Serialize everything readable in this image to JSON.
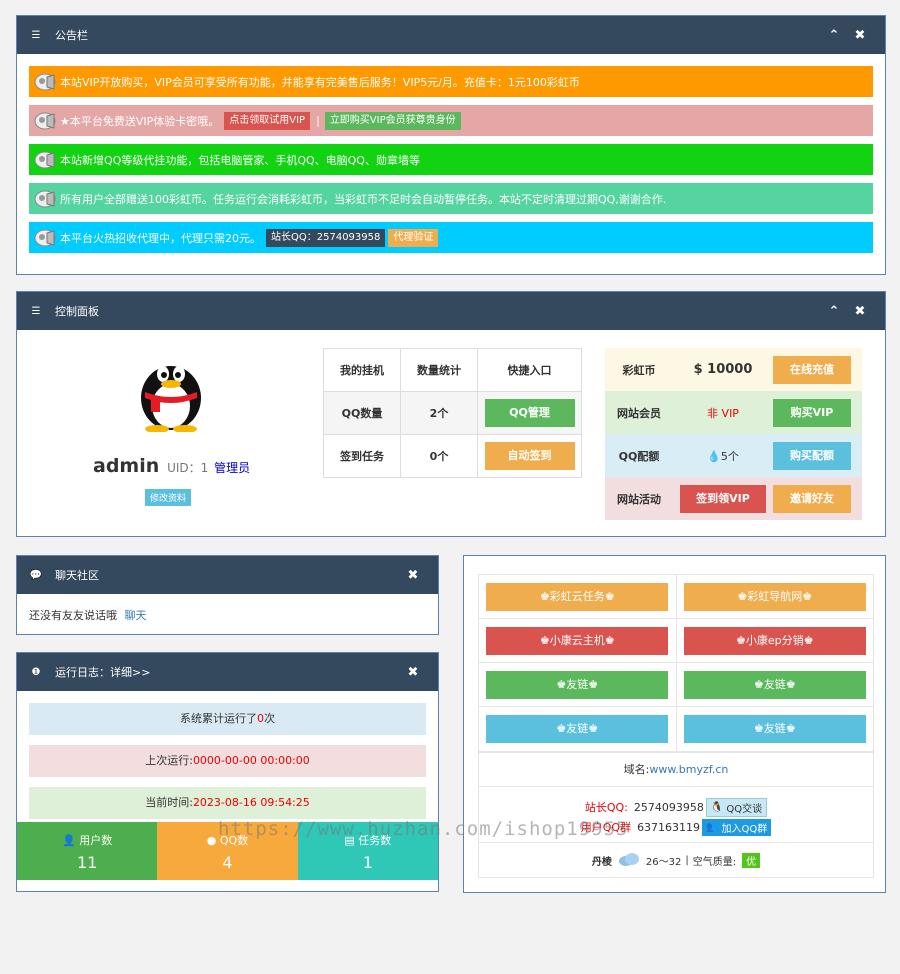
{
  "notice_panel": {
    "title": "公告栏",
    "notices": [
      {
        "text": "本站VIP开放购买，VIP会员可享受所有功能，并能享有完美售后服务！VIP5元/月。充值卡：1元100彩虹币",
        "color": "#ff9900"
      },
      {
        "text": "★本平台免费送VIP体验卡密哦。",
        "color": "#e4a7a5",
        "tag1": "点击领取试用VIP",
        "sep": "|",
        "tag2": "立即购买VIP会员获尊贵身份"
      },
      {
        "text": "本站新增QQ等级代挂功能，包括电脑管家、手机QQ、电脑QQ、勋章墙等",
        "color": "#12d312"
      },
      {
        "text": "所有用户全部赠送100彩虹币。任务运行会消耗彩虹币，当彩虹币不足时会自动暂停任务。本站不定时清理过期QQ,谢谢合作.",
        "color": "#55d4a0"
      },
      {
        "text": "本平台火热招收代理中，代理只需20元。",
        "color": "#00ccff",
        "tag1": "站长QQ：2574093958",
        "tag2": "代理验证"
      }
    ]
  },
  "control_panel": {
    "title": "控制面板",
    "user": {
      "name": "admin",
      "uid_label": "UID：1",
      "role": "管理员",
      "edit": "修改资料"
    },
    "table": {
      "headers": [
        "我的挂机",
        "数量统计",
        "快捷入口"
      ],
      "rows": [
        {
          "label": "QQ数量",
          "value": "2个",
          "button": "QQ管理"
        },
        {
          "label": "签到任务",
          "value": "0个",
          "button": "自动签到"
        }
      ]
    },
    "side": [
      {
        "label": "彩虹币",
        "value": "$ 10000",
        "button": "在线充值"
      },
      {
        "label": "网站会员",
        "value": "非 VIP",
        "button": "购买VIP"
      },
      {
        "label": "QQ配额",
        "value": "5个",
        "button": "购买配额"
      },
      {
        "label": "网站活动",
        "button": "签到领VIP",
        "button2": "邀请好友"
      }
    ]
  },
  "chat_panel": {
    "title": "聊天社区",
    "text": "还没有友友说话哦",
    "link": "聊天"
  },
  "log_panel": {
    "title": "运行日志：详细>>",
    "run_count_prefix": "系统累计运行了",
    "run_count": "0",
    "run_count_suffix": "次",
    "last_run_label": "上次运行:",
    "last_run": "0000-00-00 00:00:00",
    "now_label": "当前时间:",
    "now": "2023-08-16 09:54:25",
    "stats": [
      {
        "label": "用户数",
        "value": "11"
      },
      {
        "label": "QQ数",
        "value": "4"
      },
      {
        "label": "任务数",
        "value": "1"
      }
    ]
  },
  "links_panel": {
    "links": [
      "♚彩虹云任务♚",
      "♚彩虹导航网♚",
      "♚小康云主机♚",
      "♚小康ep分销♚",
      "♚友链♚",
      "♚友链♚",
      "♚友链♚",
      "♚友链♚"
    ],
    "domain_label": "域名:",
    "domain": "www.bmyzf.cn",
    "owner_label": "站长QQ:",
    "owner_qq": "2574093958",
    "chat_btn": "QQ交谈",
    "group_label": "用户QQ群",
    "group_qq": "637163119",
    "group_btn": "加入QQ群",
    "weather_city": "丹棱",
    "weather_temp": "26～32",
    "weather_sep": "|",
    "air_label": "空气质量:",
    "air_value": "优"
  },
  "watermark": "https://www.huzhan.com/ishop19955"
}
